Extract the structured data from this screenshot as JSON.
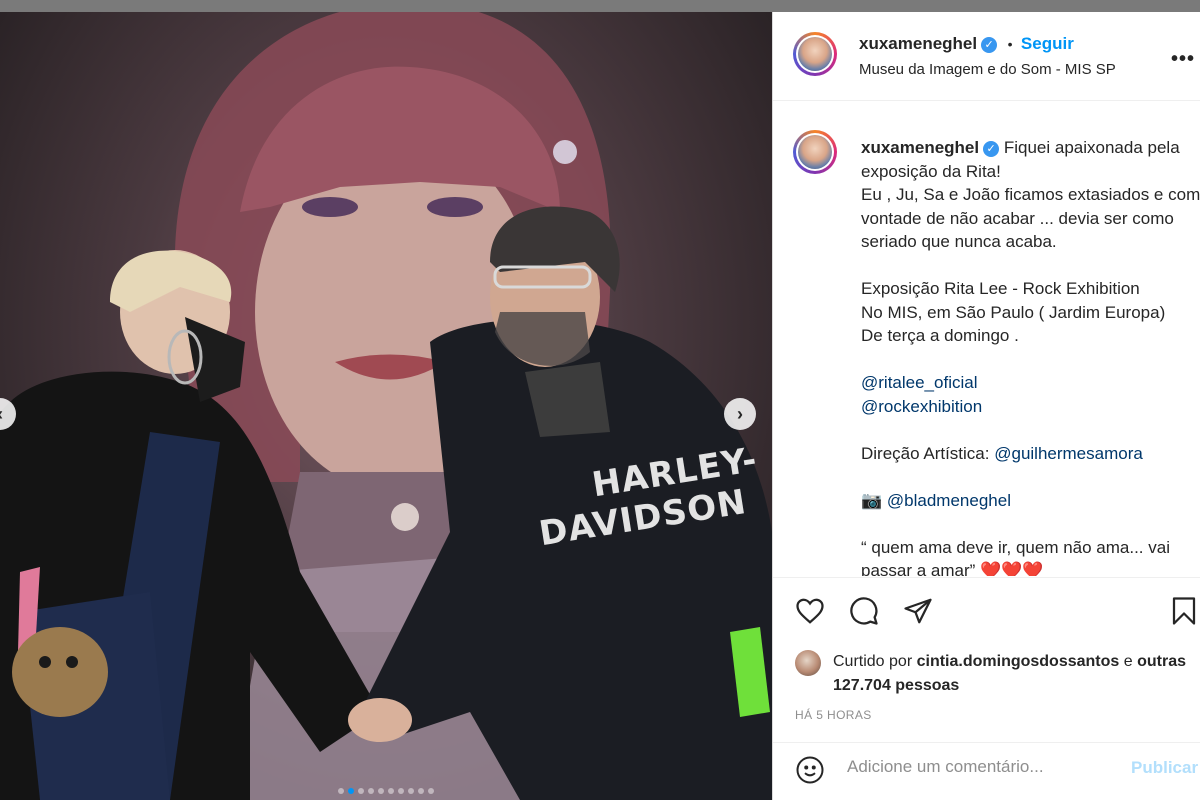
{
  "post": {
    "username": "xuxameneghel",
    "follow_label": "Seguir",
    "separator": "•",
    "location": "Museu da Imagem e do Som - MIS SP",
    "more_label": "•••",
    "verified_mark": "✓"
  },
  "caption": {
    "line1": "Fiquei apaixonada pela exposição da Rita!",
    "line2": "Eu , Ju, Sa e João ficamos extasiados e com vontade de não acabar ... devia ser como seriado que nunca acaba.",
    "line3": "Exposição Rita Lee - Rock Exhibition",
    "line4": "No MIS, em São Paulo ( Jardim Europa)",
    "line5": "De terça a domingo .",
    "mention1": "@ritalee_oficial",
    "mention2": "@rockexhibition",
    "direction_label": "Direção Artística:",
    "mention3": "@guilhermesamora",
    "camera_emoji": "📷",
    "mention4": "@bladmeneghel",
    "quote": "“ quem ama deve ir, quem não ama... vai passar a amar” ❤️❤️❤️"
  },
  "photo_text": {
    "shirt_line1": "HARLEY-",
    "shirt_line2": "DAVIDSON"
  },
  "likes": {
    "prefix": "Curtido por",
    "user": "cintia.domingosdossantos",
    "connector": "e",
    "others": "outras 127.704 pessoas"
  },
  "time_ago": "HÁ 5 HORAS",
  "comment": {
    "placeholder": "Adicione um comentário...",
    "publish_label": "Publicar"
  },
  "carousel": {
    "dot_count": 10,
    "active_index": 1,
    "next_arrow": "›",
    "prev_arrow": "‹"
  },
  "icons": [
    "heart-icon",
    "comment-icon",
    "share-icon",
    "bookmark-icon",
    "emoji-icon",
    "verified-icon",
    "more-options-icon"
  ],
  "colors": {
    "accent": "#0095f6",
    "verified": "#3897f0",
    "publish_disabled": "#b2dffc",
    "muted": "#8e8e8e"
  }
}
